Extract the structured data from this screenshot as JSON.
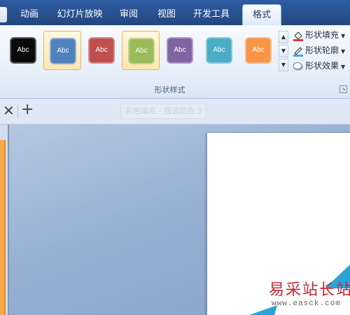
{
  "ribbon_tabs": [
    {
      "label": "动画",
      "active": false
    },
    {
      "label": "幻灯片放映",
      "active": false
    },
    {
      "label": "审阅",
      "active": false
    },
    {
      "label": "视图",
      "active": false
    },
    {
      "label": "开发工具",
      "active": false
    },
    {
      "label": "格式",
      "active": true
    }
  ],
  "shape_styles": {
    "group_label": "形状样式",
    "swatches": [
      {
        "label": "Abc",
        "color": "#0a0a0a"
      },
      {
        "label": "Abc",
        "color": "#4f81bd"
      },
      {
        "label": "Abc",
        "color": "#c0504d"
      },
      {
        "label": "Abc",
        "color": "#9bbb59"
      },
      {
        "label": "Abc",
        "color": "#8064a2"
      },
      {
        "label": "Abc",
        "color": "#4bacc6"
      },
      {
        "label": "Abc",
        "color": "#f79646"
      }
    ],
    "commands": {
      "fill": "形状填充",
      "outline": "形状轮廓",
      "effects": "形状效果"
    },
    "tooltip": "彩色填充 - 强调颜色 3"
  },
  "watermark": {
    "text": "易采站长站",
    "url": "www.easck.com"
  }
}
